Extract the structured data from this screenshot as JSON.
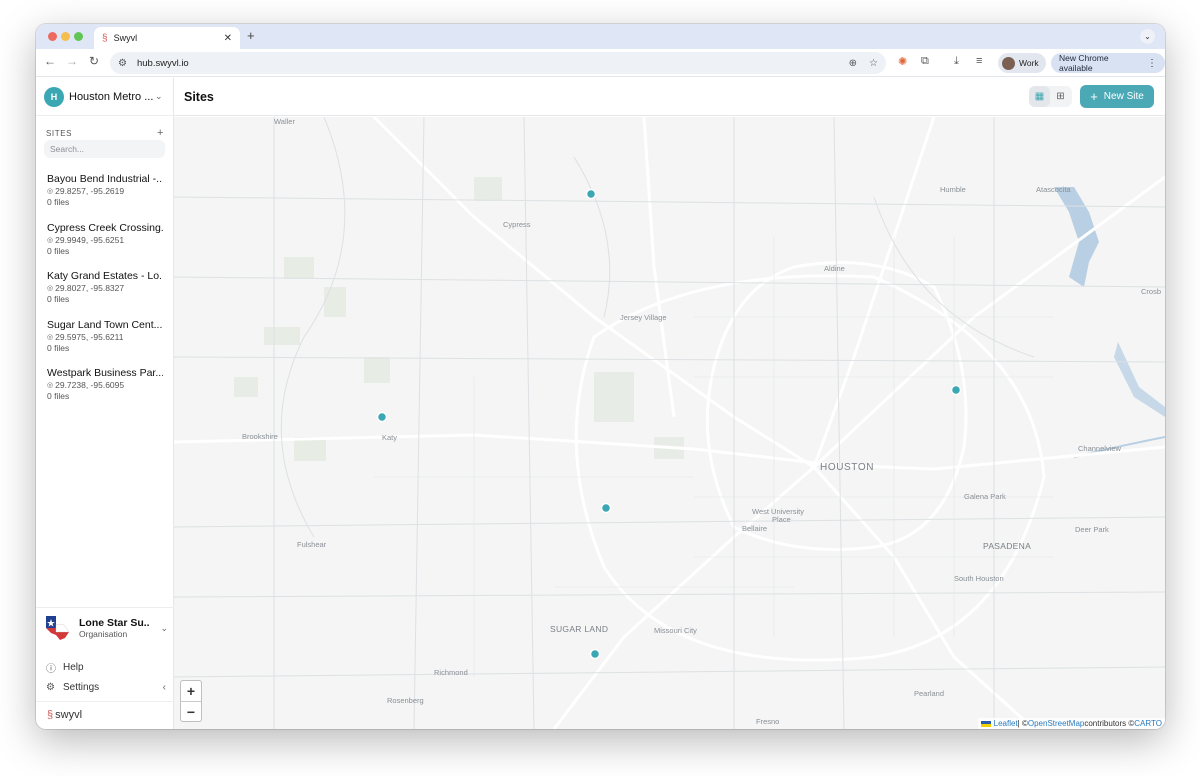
{
  "browser": {
    "tab_title": "Swyvl",
    "url": "hub.swyvl.io",
    "profile_label": "Work",
    "update_label": "New Chrome available"
  },
  "sidebar": {
    "workspace_initial": "H",
    "workspace_name": "Houston Metro ...",
    "sites_header": "SITES",
    "search_placeholder": "Search...",
    "sites": [
      {
        "name": "Bayou Bend Industrial -...",
        "coords": "29.8257, -95.2619",
        "files": "0 files"
      },
      {
        "name": "Cypress Creek Crossing...",
        "coords": "29.9949, -95.6251",
        "files": "0 files"
      },
      {
        "name": "Katy Grand Estates - Lo...",
        "coords": "29.8027, -95.8327",
        "files": "0 files"
      },
      {
        "name": "Sugar Land Town Cent...",
        "coords": "29.5975, -95.6211",
        "files": "0 files"
      },
      {
        "name": "Westpark Business Par...",
        "coords": "29.7238, -95.6095",
        "files": "0 files"
      }
    ],
    "org_name": "Lone Star Su...",
    "org_type": "Organisation",
    "help_label": "Help",
    "settings_label": "Settings",
    "brand": "swyvl"
  },
  "main": {
    "title": "Sites",
    "new_site_label": "New Site"
  },
  "map": {
    "places": [
      {
        "name": "Waller"
      },
      {
        "name": "Cypress"
      },
      {
        "name": "Humble"
      },
      {
        "name": "Atascocita"
      },
      {
        "name": "Aldine"
      },
      {
        "name": "Crosb"
      },
      {
        "name": "Jersey Village"
      },
      {
        "name": "Brookshire"
      },
      {
        "name": "Katy"
      },
      {
        "name": "Channelview"
      },
      {
        "name": "HOUSTON"
      },
      {
        "name": "Galena Park"
      },
      {
        "name": "West University"
      },
      {
        "name": "Place"
      },
      {
        "name": "Bellaire"
      },
      {
        "name": "Deer Park"
      },
      {
        "name": "Fulshear"
      },
      {
        "name": "PASADENA"
      },
      {
        "name": "South Houston"
      },
      {
        "name": "SUGAR LAND"
      },
      {
        "name": "Missouri City"
      },
      {
        "name": "Richmond"
      },
      {
        "name": "Rosenberg"
      },
      {
        "name": "Pearland"
      },
      {
        "name": "Fresno"
      }
    ],
    "zoom_in": "+",
    "zoom_out": "−",
    "attribution": {
      "leaflet": "Leaflet",
      "sep": " | © ",
      "osm": "OpenStreetMap",
      "contrib": " contributors © ",
      "carto": "CARTO"
    },
    "marker_color": "#3aa7b3"
  }
}
